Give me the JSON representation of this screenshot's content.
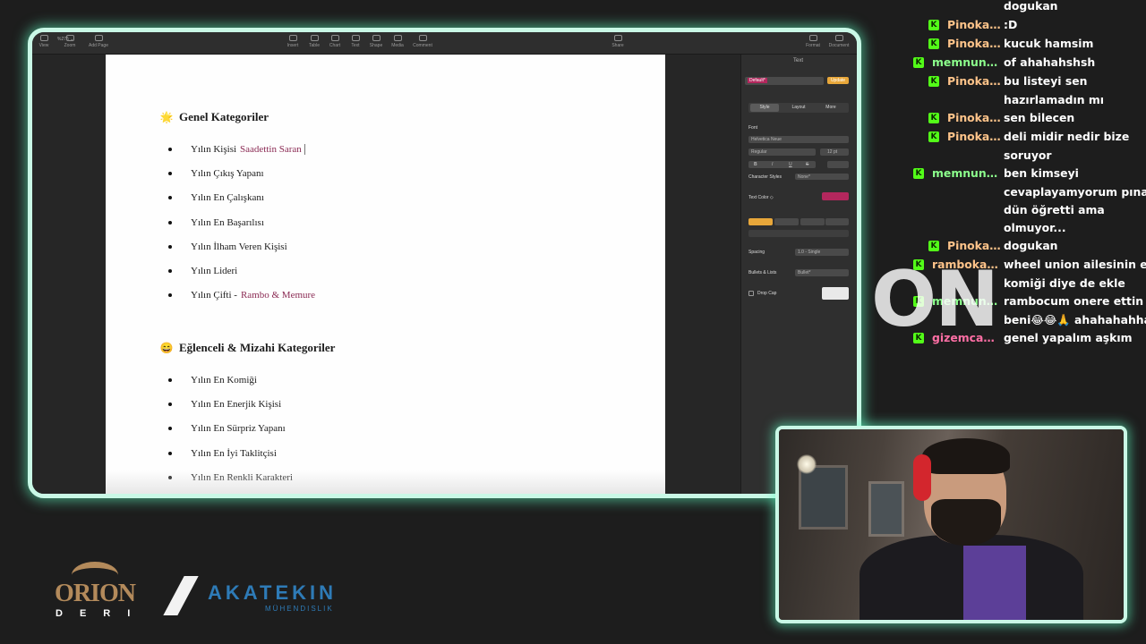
{
  "toolbar": {
    "zoom_value": "%275 ⌄",
    "items": [
      {
        "label": "View"
      },
      {
        "label": "Zoom"
      },
      {
        "label": "Add Page"
      },
      {
        "label": "Insert"
      },
      {
        "label": "Table"
      },
      {
        "label": "Chart"
      },
      {
        "label": "Text"
      },
      {
        "label": "Shape"
      },
      {
        "label": "Media"
      },
      {
        "label": "Comment"
      },
      {
        "label": "Share"
      },
      {
        "label": "Format"
      },
      {
        "label": "Document"
      }
    ]
  },
  "document": {
    "sections": [
      {
        "emoji": "🌟",
        "heading": "Genel Kategoriler",
        "items": [
          {
            "text": "Yılın Kişisi",
            "highlight": "Saadettin Saran"
          },
          {
            "text": "Yılın Çıkış Yapanı",
            "highlight": ""
          },
          {
            "text": "Yılın En Çalışkanı",
            "highlight": ""
          },
          {
            "text": "Yılın En Başarılısı",
            "highlight": ""
          },
          {
            "text": "Yılın İlham Veren Kişisi",
            "highlight": ""
          },
          {
            "text": "Yılın Lideri",
            "highlight": ""
          },
          {
            "text": "Yılın Çifti -",
            "highlight": "Rambo & Memure"
          }
        ]
      },
      {
        "emoji": "😄",
        "heading": "Eğlenceli & Mizahi Kategoriler",
        "items": [
          {
            "text": "Yılın En Komiği",
            "highlight": ""
          },
          {
            "text": "Yılın En Enerjik Kişisi",
            "highlight": ""
          },
          {
            "text": "Yılın En Sürpriz Yapanı",
            "highlight": ""
          },
          {
            "text": "Yılın En İyi Taklitçisi",
            "highlight": ""
          },
          {
            "text": "Yılın En Renkli Karakteri",
            "highlight": ""
          }
        ]
      }
    ]
  },
  "format_panel": {
    "title": "Text",
    "paragraph_style": "Default*",
    "update_label": "Update",
    "tabs": [
      "Style",
      "Layout",
      "More"
    ],
    "font_label": "Font",
    "font_name": "Helvetica Neue",
    "font_weight": "Regular",
    "font_size": "12 pt",
    "style_buttons": [
      "B",
      "I",
      "U",
      "S"
    ],
    "character_styles_label": "Character Styles",
    "character_styles_value": "None*",
    "text_color_label": "Text Color ◇",
    "text_color": "#b3275d",
    "spacing_label": "Spacing",
    "spacing_value": "1.0 - Single",
    "bullets_label": "Bullets & Lists",
    "bullets_value": "Bullet*",
    "drop_cap_label": "Drop Cap",
    "accent_color": "#e8a73a"
  },
  "chat": {
    "username_colors": {
      "Pinokaan": "#ffc48a",
      "memnune...": "#8cff8c",
      "rambokan...": "#ffc48a",
      "gizemcan...": "#ff6fa5"
    },
    "messages": [
      {
        "user": "",
        "user_color": "",
        "lines": [
          "dogukan"
        ]
      },
      {
        "user": "Pinokaan",
        "user_color": "#ffc48a",
        "lines": [
          ":D"
        ]
      },
      {
        "user": "Pinokaan",
        "user_color": "#ffc48a",
        "lines": [
          "kucuk hamsim"
        ]
      },
      {
        "user": "memnune...",
        "user_color": "#8cff8c",
        "lines": [
          "of ahahahshsh"
        ]
      },
      {
        "user": "Pinokaan",
        "user_color": "#ffc48a",
        "lines": [
          "bu listeyi sen",
          "hazırlamadın mı"
        ]
      },
      {
        "user": "Pinokaan",
        "user_color": "#ffc48a",
        "lines": [
          "sen bilecen"
        ]
      },
      {
        "user": "Pinokaan",
        "user_color": "#ffc48a",
        "lines": [
          "deli midir nedir bize",
          "soruyor"
        ]
      },
      {
        "user": "memnune...",
        "user_color": "#8cff8c",
        "lines": [
          "ben kimseyi",
          "cevaplayamyorum pınar",
          "dün öğretti ama",
          "olmuyor..."
        ]
      },
      {
        "user": "Pinokaan",
        "user_color": "#ffc48a",
        "lines": [
          "dogukan"
        ]
      },
      {
        "user": "rambokan...",
        "user_color": "#ffc48a",
        "lines": [
          "wheel union ailesinin en",
          "komiği diye de ekle"
        ]
      },
      {
        "user": "memnune...",
        "user_color": "#8cff8c",
        "lines": [
          "rambocum onere ettin",
          "beni😂😂🙏 ahahahahha"
        ]
      },
      {
        "user": "gizemcan...",
        "user_color": "#ff6fa5",
        "lines": [
          "genel yapalım aşkım"
        ]
      }
    ]
  },
  "overlay_text": "ON",
  "brand_colors": {
    "frame_glow": "#60ffc4",
    "kick_green": "#53fc18"
  },
  "logos": {
    "orion_name": "ORION",
    "orion_sub": "DERI",
    "akatekin_name": "AKATEKIN",
    "akatekin_sub": "MÜHENDISLIK"
  }
}
